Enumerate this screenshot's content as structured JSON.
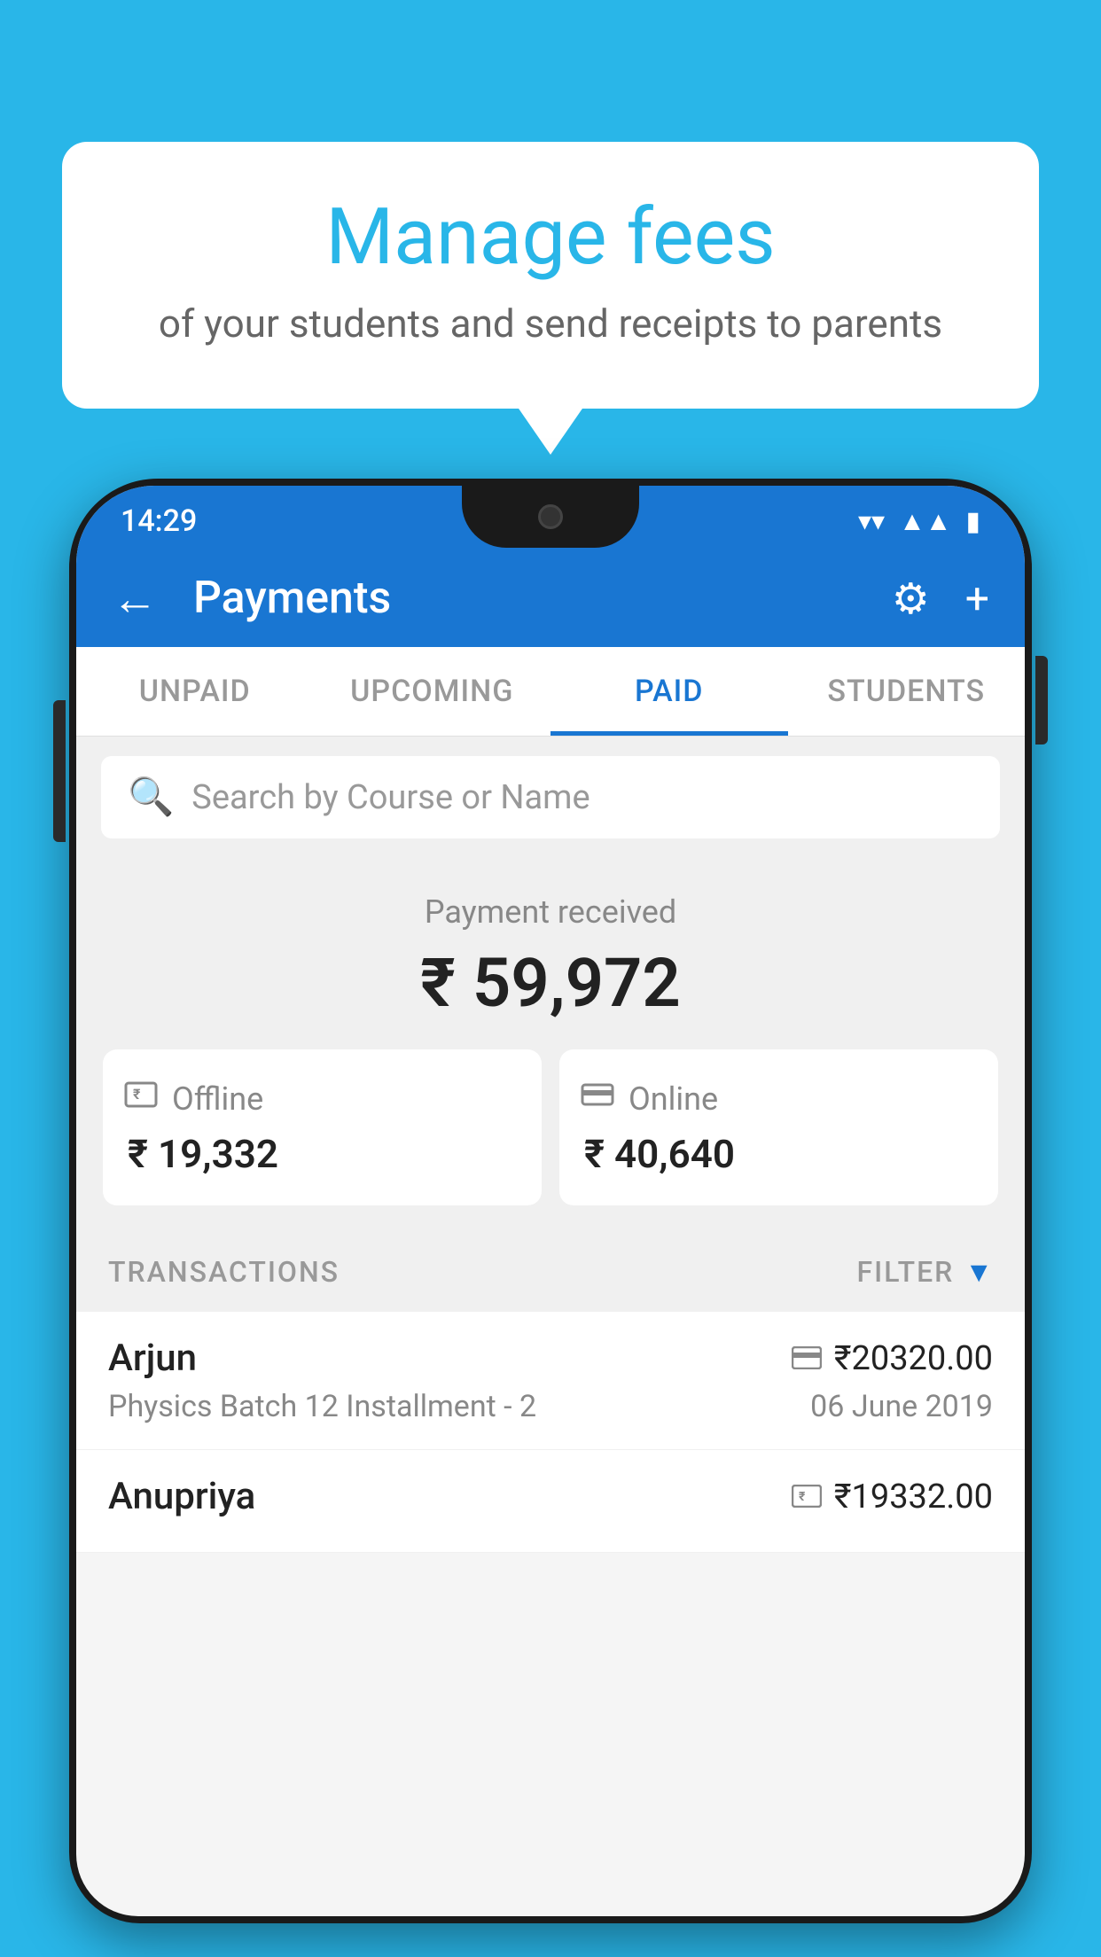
{
  "background_color": "#29b6e8",
  "speech_bubble": {
    "title": "Manage fees",
    "subtitle": "of your students and send receipts to parents"
  },
  "status_bar": {
    "time": "14:29",
    "wifi": "▼",
    "signal": "▲",
    "battery": "▮"
  },
  "app_bar": {
    "title": "Payments",
    "back_label": "←",
    "gear_label": "⚙",
    "plus_label": "+"
  },
  "tabs": [
    {
      "label": "UNPAID",
      "active": false
    },
    {
      "label": "UPCOMING",
      "active": false
    },
    {
      "label": "PAID",
      "active": true
    },
    {
      "label": "STUDENTS",
      "active": false
    }
  ],
  "search": {
    "placeholder": "Search by Course or Name"
  },
  "payment_summary": {
    "received_label": "Payment received",
    "total_amount": "₹ 59,972",
    "offline": {
      "label": "Offline",
      "amount": "₹ 19,332"
    },
    "online": {
      "label": "Online",
      "amount": "₹ 40,640"
    }
  },
  "transactions": {
    "header_label": "TRANSACTIONS",
    "filter_label": "FILTER",
    "rows": [
      {
        "name": "Arjun",
        "course": "Physics Batch 12 Installment - 2",
        "amount": "₹20320.00",
        "date": "06 June 2019",
        "payment_type": "card"
      },
      {
        "name": "Anupriya",
        "course": "",
        "amount": "₹19332.00",
        "date": "",
        "payment_type": "offline"
      }
    ]
  }
}
